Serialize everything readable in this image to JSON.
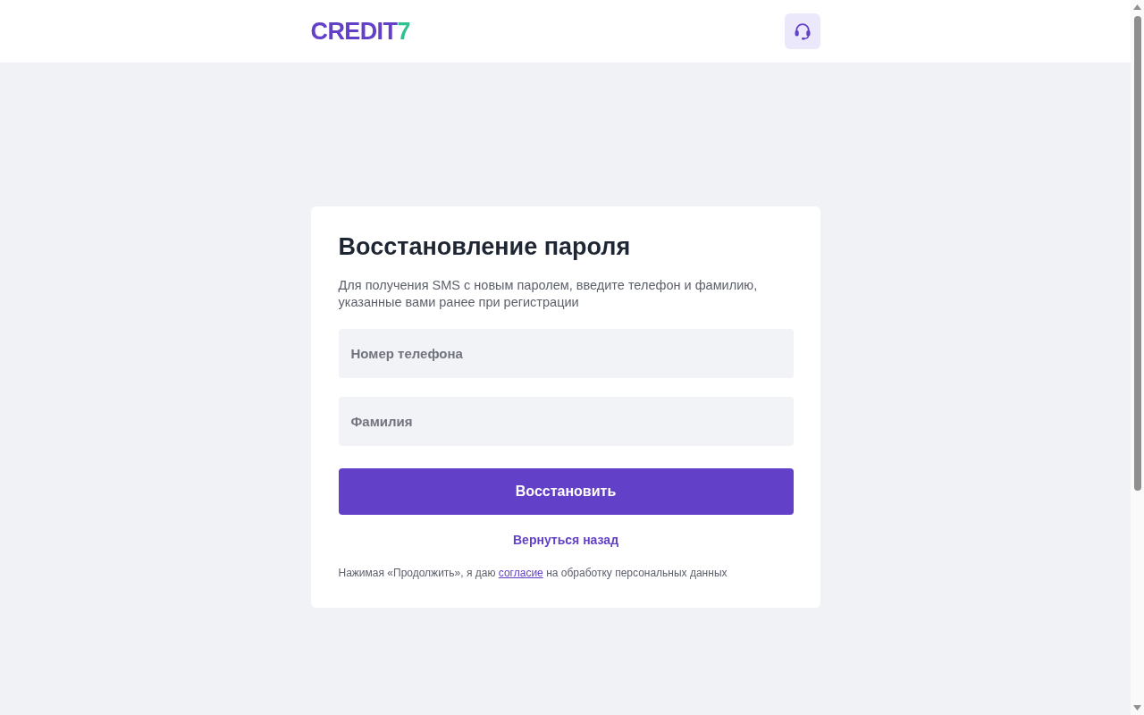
{
  "header": {
    "logo": {
      "text": "CREDIT",
      "accent": "7"
    }
  },
  "recovery_form": {
    "title": "Восстановление пароля",
    "description": "Для получения SMS с новым паролем, введите телефон и фамилию, указанные вами ранее при регистрации",
    "fields": [
      {
        "placeholder": "Номер телефона"
      },
      {
        "placeholder": "Фамилия"
      }
    ],
    "submit_button": "Восстановить",
    "back_link": "Вернуться назад",
    "consent": {
      "before": "Нажимая «Продолжить», я даю",
      "link": "согласие",
      "after": "на обработку персональных данных"
    }
  }
}
